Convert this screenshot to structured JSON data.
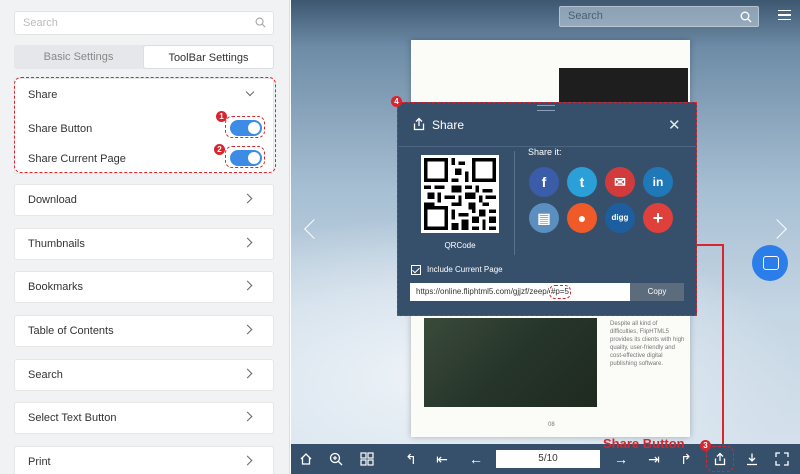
{
  "sidebar": {
    "search_placeholder": "Search",
    "tabs": [
      {
        "label": "Basic Settings"
      },
      {
        "label": "ToolBar Settings"
      }
    ],
    "share": {
      "title": "Share",
      "share_button_label": "Share Button",
      "share_current_page_label": "Share Current Page",
      "share_button_enabled": true,
      "share_current_page_enabled": true
    },
    "items": [
      {
        "label": "Download"
      },
      {
        "label": "Thumbnails"
      },
      {
        "label": "Bookmarks"
      },
      {
        "label": "Table of Contents"
      },
      {
        "label": "Search"
      },
      {
        "label": "Select Text Button"
      },
      {
        "label": "Print"
      }
    ]
  },
  "annotations": {
    "n1": "1",
    "n2": "2",
    "n3": "3",
    "n4": "4",
    "share_button_callout": "Share Button"
  },
  "viewer": {
    "search_placeholder": "Search",
    "book_text": "Despite all kind of difficulties, FlipHTML5 provides its clients with high quality, user-friendly and cost-effective digital publishing software.",
    "page_number": "08",
    "page_indicator": "5/10"
  },
  "share_modal": {
    "title": "Share",
    "qr_label": "QRCode",
    "share_it_label": "Share it:",
    "include_label": "Include Current Page",
    "url": "https://online.fliphtml5.com/gjjzf/zeep/",
    "url_hash": "#p=5",
    "copy_label": "Copy",
    "social": [
      {
        "name": "facebook-icon",
        "glyph": "f",
        "color": "#3b5ca8"
      },
      {
        "name": "twitter-icon",
        "glyph": "t",
        "color": "#2a9fd8"
      },
      {
        "name": "email-icon",
        "glyph": "✉",
        "color": "#d23b3b"
      },
      {
        "name": "linkedin-icon",
        "glyph": "in",
        "color": "#1f78b8"
      },
      {
        "name": "blogger-icon",
        "glyph": "▤",
        "color": "#5a8fc0"
      },
      {
        "name": "reddit-icon",
        "glyph": "●",
        "color": "#f05a28"
      },
      {
        "name": "digg-icon",
        "glyph": "digg",
        "color": "#1d5f9e"
      },
      {
        "name": "more-share-icon",
        "glyph": "+",
        "color": "#e0403b"
      }
    ]
  },
  "colors": {
    "accent": "#3c8ce6",
    "annotation": "#d7262f",
    "toolbar": "#36506b"
  }
}
